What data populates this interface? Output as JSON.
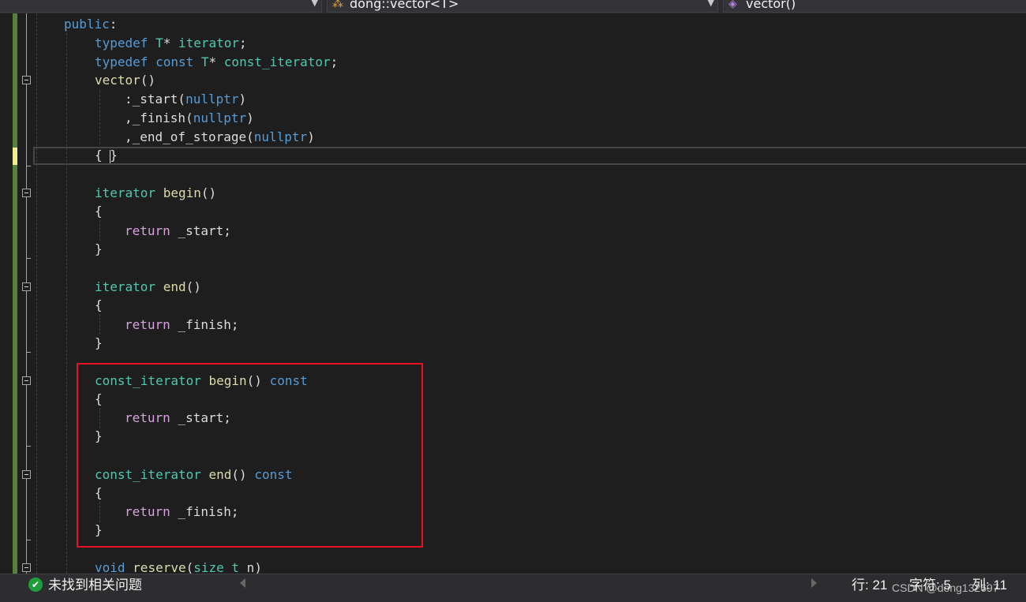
{
  "navbar": {
    "left_dropdown": {
      "label": ""
    },
    "class_dropdown": {
      "label": "dong::vector<T>",
      "icon": "class-template-icon"
    },
    "member_dropdown": {
      "label": "vector()",
      "icon": "method-icon"
    }
  },
  "code": {
    "l1": {
      "a": "public",
      "b": ":"
    },
    "l2": {
      "a": "typedef",
      "b": " ",
      "c": "T",
      "d": "* ",
      "e": "iterator",
      "f": ";"
    },
    "l3": {
      "a": "typedef",
      "b": " ",
      "c": "const",
      "d": " ",
      "e": "T",
      "f": "* ",
      "g": "const_iterator",
      "h": ";"
    },
    "l4": {
      "a": "vector",
      "b": "()"
    },
    "l5": {
      "a": ":_start(",
      "b": "nullptr",
      "c": ")"
    },
    "l6": {
      "a": ",_finish(",
      "b": "nullptr",
      "c": ")"
    },
    "l7": {
      "a": ",_end_of_storage(",
      "b": "nullptr",
      "c": ")"
    },
    "l8": {
      "a": "{ }"
    },
    "l9": {
      "a": "iterator",
      "b": " ",
      "c": "begin",
      "d": "()"
    },
    "l10": {
      "a": "{"
    },
    "l11": {
      "a": "return",
      "b": " _start;"
    },
    "l12": {
      "a": "}"
    },
    "l13": {
      "a": "iterator",
      "b": " ",
      "c": "end",
      "d": "()"
    },
    "l14": {
      "a": "{"
    },
    "l15": {
      "a": "return",
      "b": " _finish;"
    },
    "l16": {
      "a": "}"
    },
    "l17": {
      "a": "const_iterator",
      "b": " ",
      "c": "begin",
      "d": "() ",
      "e": "const"
    },
    "l18": {
      "a": "{"
    },
    "l19": {
      "a": "return",
      "b": " _start;"
    },
    "l20": {
      "a": "}"
    },
    "l21": {
      "a": "const_iterator",
      "b": " ",
      "c": "end",
      "d": "() ",
      "e": "const"
    },
    "l22": {
      "a": "{"
    },
    "l23": {
      "a": "return",
      "b": " _finish;"
    },
    "l24": {
      "a": "}"
    },
    "l25": {
      "a": "void",
      "b": " ",
      "c": "reserve",
      "d": "(",
      "e": "size_t",
      "f": " n)"
    }
  },
  "statusbar": {
    "problems": "未找到相关问题",
    "line": "行: 21",
    "char": "字符: 5",
    "col": "列: 11",
    "watermark": "CSDN @dong132697"
  },
  "colors": {
    "keyword": "#569cd6",
    "type": "#4ec9b0",
    "function": "#dcdcaa",
    "control": "#d8a0df",
    "highlight_box": "#e81123",
    "change_bar_saved": "#57803c",
    "change_bar_unsaved": "#efef91"
  }
}
